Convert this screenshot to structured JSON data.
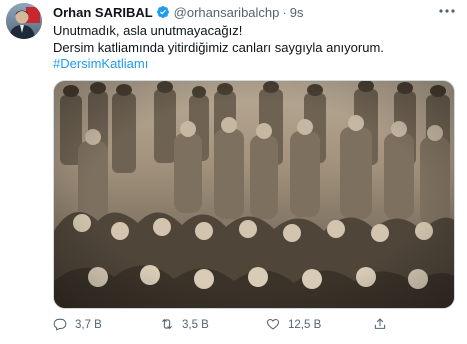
{
  "tweet": {
    "author_name": "Orhan SARIBAL",
    "handle": "@orhansaribalchp",
    "separator": "·",
    "time": "9s",
    "text_lines": [
      "Unutmadık, asla unutmayacağız!",
      "Dersim katliamında yitirdiğimiz canları saygıyla anıyorum."
    ],
    "hashtag": "#DersimKatliamı"
  },
  "icons": {
    "verified": "verified-badge-icon",
    "more": "more-options-icon",
    "reply": "reply-icon",
    "retweet": "retweet-icon",
    "like": "like-icon",
    "share": "share-icon"
  },
  "actions": {
    "replies": "3,7 B",
    "retweets": "3,5 B",
    "likes": "12,5 B"
  },
  "colors": {
    "accent": "#1d9bf0",
    "secondary_text": "#536471",
    "text": "#0f1419",
    "photo_tone": "#8b7e6c"
  }
}
